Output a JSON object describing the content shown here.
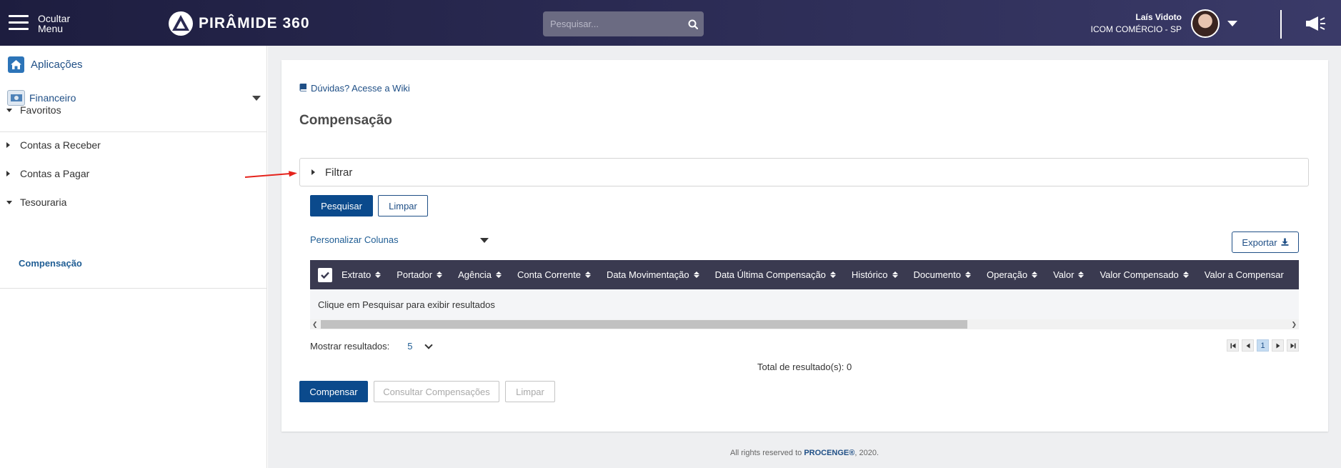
{
  "header": {
    "hide_menu_label": "Ocultar\nMenu",
    "logo_text": "PIRÂMIDE 360",
    "search_placeholder": "Pesquisar...",
    "user_name": "Laís Vidoto",
    "company": "ICOM COMÉRCIO - SP"
  },
  "sidebar": {
    "apps_label": "Aplicações",
    "module_label": "Financeiro",
    "favorites_label": "Favoritos",
    "items": [
      {
        "label": "Contas a Receber",
        "expanded": false
      },
      {
        "label": "Contas a Pagar",
        "expanded": false
      },
      {
        "label": "Tesouraria",
        "expanded": true
      }
    ],
    "active_sub_item": "Compensação"
  },
  "main": {
    "wiki_link": "Dúvidas? Acesse a Wiki",
    "page_title": "Compensação",
    "filter_label": "Filtrar",
    "search_button": "Pesquisar",
    "clear_button": "Limpar",
    "customize_columns": "Personalizar Colunas",
    "export_button": "Exportar",
    "table": {
      "columns": [
        "Extrato",
        "Portador",
        "Agência",
        "Conta Corrente",
        "Data Movimentação",
        "Data Última Compensação",
        "Histórico",
        "Documento",
        "Operação",
        "Valor",
        "Valor Compensado",
        "Valor a Compensar"
      ],
      "empty_message": "Clique em Pesquisar para exibir resultados"
    },
    "show_results_label": "Mostrar resultados:",
    "page_size": "5",
    "current_page": "1",
    "total_results": "Total de resultado(s): 0",
    "compensate_button": "Compensar",
    "consult_button": "Consultar Compensações",
    "clear_bottom_button": "Limpar"
  },
  "footer": {
    "text_prefix": "All rights reserved to ",
    "brand": "PROCENGE®",
    "text_suffix": ", 2020."
  },
  "colors": {
    "header_bg": "#2a2a52",
    "primary": "#0b4a8c",
    "link": "#1f4f86",
    "table_header": "#3a3a50"
  }
}
